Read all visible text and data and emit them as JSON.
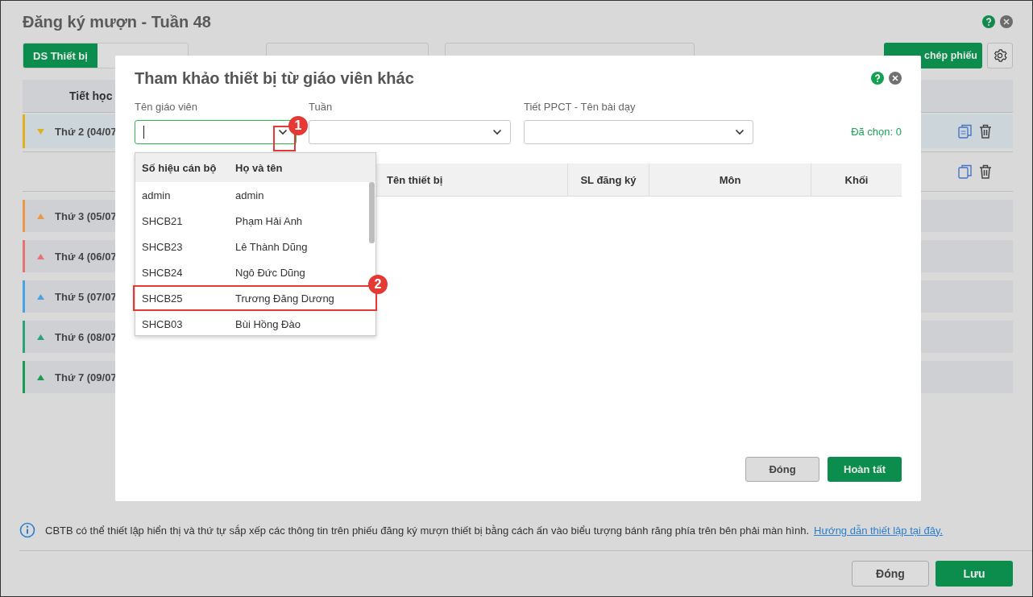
{
  "page": {
    "title": "Đăng ký mượn - Tuần 48",
    "tabs": [
      {
        "label": "DS Thiết bị",
        "selected": true
      },
      {
        "selected": false
      }
    ],
    "copy_button": "chép phiếu",
    "table_header": "Tiết học",
    "days": [
      {
        "label": "Thứ 2 (04/07",
        "color": "#e0b020",
        "expanded": true
      },
      {
        "label": "Thứ 3 (05/07",
        "color": "#e8994a",
        "expanded": false
      },
      {
        "label": "Thứ 4 (06/07",
        "color": "#e57373",
        "expanded": false
      },
      {
        "label": "Thứ 5 (07/07",
        "color": "#4aa3df",
        "expanded": false
      },
      {
        "label": "Thứ 6 (08/07",
        "color": "#2aa37a",
        "expanded": false
      },
      {
        "label": "Thứ 7 (09/07",
        "color": "#179c52",
        "expanded": false
      }
    ],
    "info": "CBTB có thể thiết lập hiển thị và thứ tự sắp xếp các thông tin trên phiếu đăng ký mượn thiết bị bằng cách ấn vào biểu tượng bánh răng phía trên bên phải màn hình.",
    "info_link": "Hướng dẫn thiết lập tại đây.",
    "footer_buttons": [
      {
        "label": "Đóng",
        "kind": "secondary"
      },
      {
        "label": "Lưu",
        "kind": "primary"
      }
    ]
  },
  "dialog": {
    "title": "Tham khảo thiết bị từ giáo viên khác",
    "fields": [
      {
        "label": "Tên giáo viên",
        "focused": true
      },
      {
        "label": "Tuần",
        "focused": false
      },
      {
        "label": "Tiết PPCT - Tên bài dạy",
        "focused": false
      }
    ],
    "selected_count": "Đã chọn: 0",
    "columns": [
      "Tên thiết bị",
      "SL đăng ký",
      "Môn",
      "Khối"
    ],
    "dropdown": {
      "columns": [
        "Số hiệu cán bộ",
        "Họ và tên"
      ],
      "rows": [
        {
          "code": "admin",
          "name": "admin",
          "highlighted": false
        },
        {
          "code": "SHCB21",
          "name": "Phạm Hải Anh",
          "highlighted": false
        },
        {
          "code": "SHCB23",
          "name": "Lê Thành Dũng",
          "highlighted": false
        },
        {
          "code": "SHCB24",
          "name": "Ngô Đức Dũng",
          "highlighted": false
        },
        {
          "code": "SHCB25",
          "name": "Trương Đăng Dương",
          "highlighted": true
        },
        {
          "code": "SHCB03",
          "name": "Bùi Hồng Đào",
          "highlighted": false
        }
      ]
    },
    "buttons": [
      {
        "label": "Đóng",
        "kind": "secondary"
      },
      {
        "label": "Hoàn tất",
        "kind": "primary"
      }
    ],
    "step_badges": [
      "1",
      "2"
    ]
  }
}
